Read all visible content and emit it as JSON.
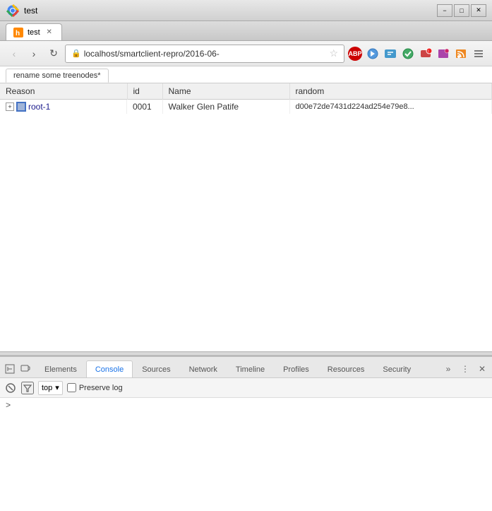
{
  "window": {
    "title": "test",
    "controls": {
      "minimize": "−",
      "maximize": "□",
      "close": "✕"
    }
  },
  "browser": {
    "tab_title": "test",
    "url": "localhost/smartclient-repro/2016-06-",
    "nav": {
      "back": "‹",
      "forward": "›",
      "refresh": "↻"
    }
  },
  "page": {
    "tab_label": "rename some treenodes*"
  },
  "table": {
    "columns": [
      {
        "key": "reason",
        "label": "Reason",
        "sorted": false
      },
      {
        "key": "id",
        "label": "id",
        "sorted": false
      },
      {
        "key": "name",
        "label": "Name",
        "sorted": false
      },
      {
        "key": "random",
        "label": "random",
        "sorted": false
      }
    ],
    "rows": [
      {
        "reason": "root-1",
        "id": "0001",
        "name": "Walker Glen Patife",
        "random": "d00e72de7431d224ad254e79e8..."
      }
    ]
  },
  "devtools": {
    "tabs": [
      {
        "key": "elements",
        "label": "Elements",
        "active": false
      },
      {
        "key": "console",
        "label": "Console",
        "active": true
      },
      {
        "key": "sources",
        "label": "Sources",
        "active": false
      },
      {
        "key": "network",
        "label": "Network",
        "active": false
      },
      {
        "key": "timeline",
        "label": "Timeline",
        "active": false
      },
      {
        "key": "profiles",
        "label": "Profiles",
        "active": false
      },
      {
        "key": "resources",
        "label": "Resources",
        "active": false
      },
      {
        "key": "security",
        "label": "Security",
        "active": false
      }
    ],
    "toolbar": {
      "context_value": "top",
      "context_dropdown_char": "▾",
      "preserve_log_label": "Preserve log"
    },
    "console": {
      "prompt_char": ">"
    }
  }
}
